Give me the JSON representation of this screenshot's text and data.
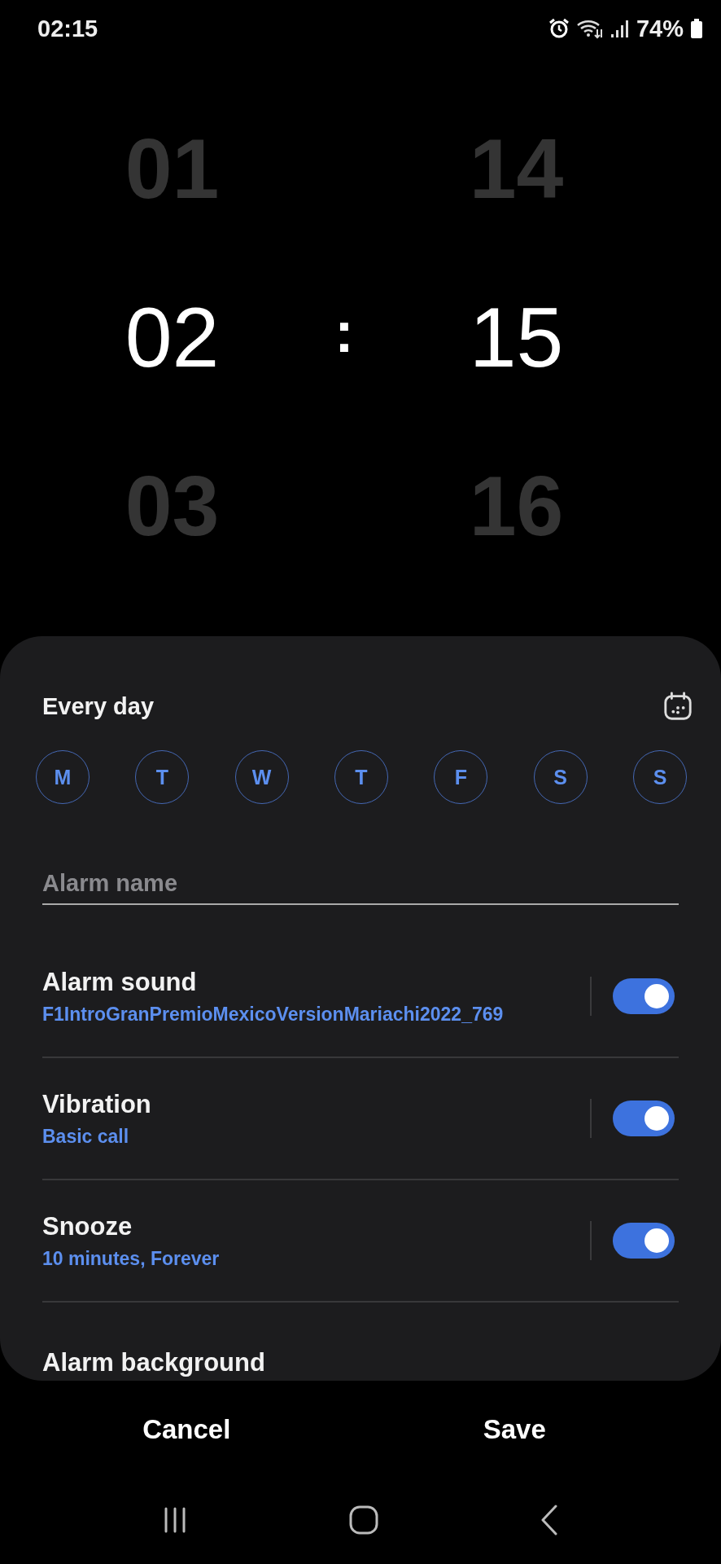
{
  "status_bar": {
    "time": "02:15",
    "battery": "74%"
  },
  "picker": {
    "hours": [
      {
        "value": "01",
        "selected": false
      },
      {
        "value": "02",
        "selected": true
      },
      {
        "value": "03",
        "selected": false
      }
    ],
    "separator": ":",
    "minutes": [
      {
        "value": "14",
        "selected": false
      },
      {
        "value": "15",
        "selected": true
      },
      {
        "value": "16",
        "selected": false
      }
    ]
  },
  "repeat_label": "Every day",
  "days": [
    {
      "label": "M",
      "selected": true
    },
    {
      "label": "T",
      "selected": true
    },
    {
      "label": "W",
      "selected": true
    },
    {
      "label": "T",
      "selected": true
    },
    {
      "label": "F",
      "selected": true
    },
    {
      "label": "S",
      "selected": true
    },
    {
      "label": "S",
      "selected": true
    }
  ],
  "alarm_name": {
    "placeholder": "Alarm name"
  },
  "settings": [
    {
      "title": "Alarm sound",
      "subtitle": "F1IntroGranPremioMexicoVersionMariachi2022_769",
      "on": true
    },
    {
      "title": "Vibration",
      "subtitle": "Basic call",
      "on": true
    },
    {
      "title": "Snooze",
      "subtitle": "10 minutes, Forever",
      "on": true
    },
    {
      "title": "Alarm background"
    }
  ],
  "buttons": [
    "Cancel",
    "Save"
  ]
}
